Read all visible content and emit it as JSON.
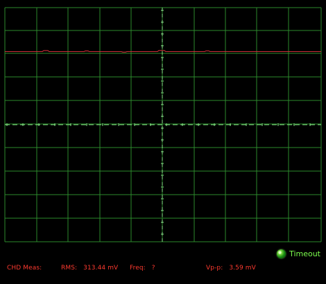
{
  "status": {
    "timeout_label": "Timeout",
    "led_color": "#48c51f"
  },
  "measurements": {
    "channel_title": "CHD Meas:",
    "rms_label": "RMS:",
    "rms_value": "313.44 mV",
    "freq_label": "Freq:",
    "freq_value": "?",
    "vpp_label": "Vp-p:",
    "vpp_value": "3.59 mV"
  },
  "display": {
    "background_color": "#000000",
    "grid_color": "#2d8a2d",
    "center_axis_color": "#89e689",
    "trace_color": "#d0303a",
    "measurement_color": "#ff3a2f",
    "timeout_text_color": "#7cff4d"
  }
}
